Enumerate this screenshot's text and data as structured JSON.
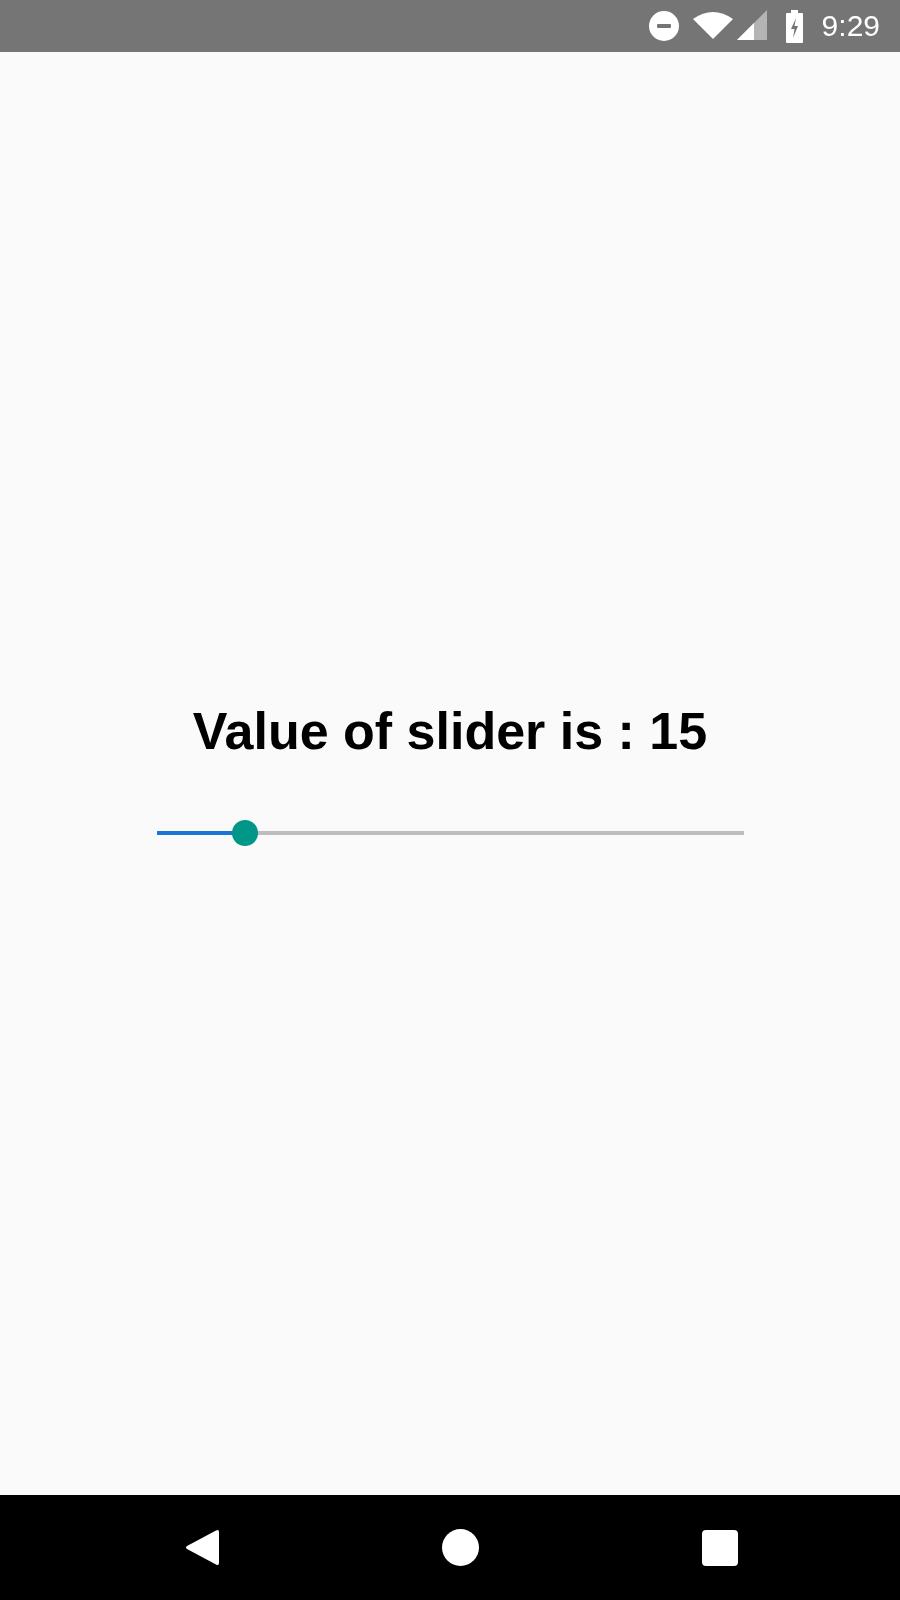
{
  "status_bar": {
    "time": "9:29"
  },
  "content": {
    "label": "Value of slider is : 15",
    "slider": {
      "level": 0.15
    }
  }
}
